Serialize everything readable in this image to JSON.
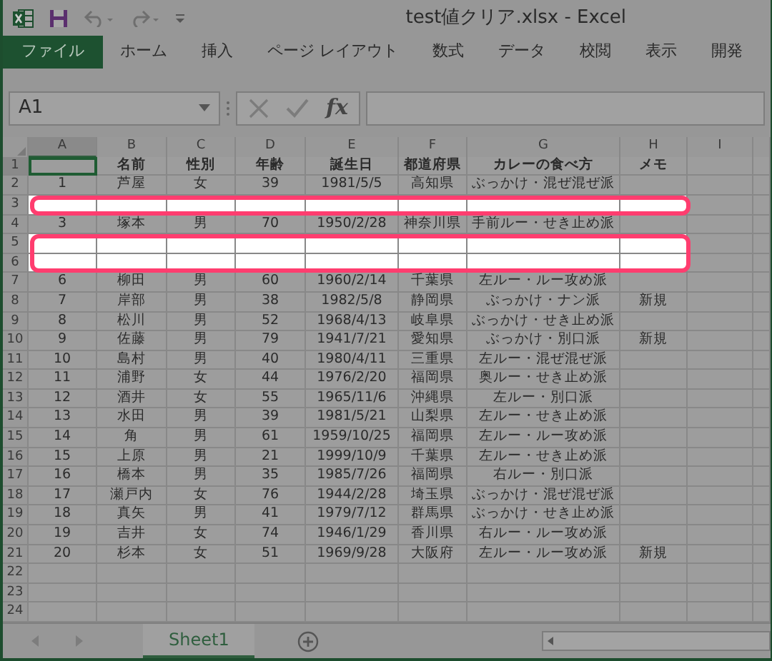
{
  "window": {
    "title": "test値クリア.xlsx - Excel"
  },
  "ribbon_tabs": [
    {
      "label": "ファイル",
      "kind": "file"
    },
    {
      "label": "ホーム",
      "kind": "tab"
    },
    {
      "label": "挿入",
      "kind": "tab"
    },
    {
      "label": "ページ レイアウト",
      "kind": "tab"
    },
    {
      "label": "数式",
      "kind": "tab"
    },
    {
      "label": "データ",
      "kind": "tab"
    },
    {
      "label": "校閲",
      "kind": "tab"
    },
    {
      "label": "表示",
      "kind": "tab"
    },
    {
      "label": "開発",
      "kind": "tab"
    }
  ],
  "name_box": "A1",
  "function_label": "fx",
  "columns": [
    {
      "label": "A",
      "selected": true
    },
    {
      "label": "B",
      "selected": false
    },
    {
      "label": "C",
      "selected": false
    },
    {
      "label": "D",
      "selected": false
    },
    {
      "label": "E",
      "selected": false
    },
    {
      "label": "F",
      "selected": false
    },
    {
      "label": "G",
      "selected": false
    },
    {
      "label": "H",
      "selected": false
    },
    {
      "label": "I",
      "selected": false
    }
  ],
  "rows": [
    {
      "number": "1",
      "kind": "header",
      "selected": true,
      "highlighted": false,
      "cells": {
        "B": "名前",
        "C": "性別",
        "D": "年齢",
        "E": "誕生日",
        "F": "都道府県",
        "G": "カレーの食べ方",
        "H": "メモ"
      }
    },
    {
      "number": "2",
      "kind": "data",
      "selected": false,
      "highlighted": false,
      "cells": {
        "A": "1",
        "B": "芦屋",
        "C": "女",
        "D": "39",
        "E": "1981/5/5",
        "F": "高知県",
        "G": "ぶっかけ・混ぜ混ぜ派"
      }
    },
    {
      "number": "3",
      "kind": "data",
      "selected": false,
      "highlighted": true,
      "cells": {}
    },
    {
      "number": "4",
      "kind": "data",
      "selected": false,
      "highlighted": false,
      "cells": {
        "A": "3",
        "B": "塚本",
        "C": "男",
        "D": "70",
        "E": "1950/2/28",
        "F": "神奈川県",
        "G": "手前ルー・せき止め派"
      }
    },
    {
      "number": "5",
      "kind": "data",
      "selected": false,
      "highlighted": true,
      "cells": {}
    },
    {
      "number": "6",
      "kind": "data",
      "selected": false,
      "highlighted": true,
      "cells": {}
    },
    {
      "number": "7",
      "kind": "data",
      "selected": false,
      "highlighted": false,
      "cells": {
        "A": "6",
        "B": "柳田",
        "C": "男",
        "D": "60",
        "E": "1960/2/14",
        "F": "千葉県",
        "G": "左ルー・ルー攻め派"
      }
    },
    {
      "number": "8",
      "kind": "data",
      "selected": false,
      "highlighted": false,
      "cells": {
        "A": "7",
        "B": "岸部",
        "C": "男",
        "D": "38",
        "E": "1982/5/8",
        "F": "静岡県",
        "G": "ぶっかけ・ナン派",
        "H": "新規"
      }
    },
    {
      "number": "9",
      "kind": "data",
      "selected": false,
      "highlighted": false,
      "cells": {
        "A": "8",
        "B": "松川",
        "C": "男",
        "D": "52",
        "E": "1968/4/13",
        "F": "岐阜県",
        "G": "ぶっかけ・せき止め派"
      }
    },
    {
      "number": "10",
      "kind": "data",
      "selected": false,
      "highlighted": false,
      "cells": {
        "A": "9",
        "B": "佐藤",
        "C": "男",
        "D": "79",
        "E": "1941/7/21",
        "F": "愛知県",
        "G": "ぶっかけ・別口派",
        "H": "新規"
      }
    },
    {
      "number": "11",
      "kind": "data",
      "selected": false,
      "highlighted": false,
      "cells": {
        "A": "10",
        "B": "島村",
        "C": "男",
        "D": "40",
        "E": "1980/4/11",
        "F": "三重県",
        "G": "左ルー・混ぜ混ぜ派"
      }
    },
    {
      "number": "12",
      "kind": "data",
      "selected": false,
      "highlighted": false,
      "cells": {
        "A": "11",
        "B": "浦野",
        "C": "女",
        "D": "44",
        "E": "1976/2/20",
        "F": "福岡県",
        "G": "奥ルー・せき止め派"
      }
    },
    {
      "number": "13",
      "kind": "data",
      "selected": false,
      "highlighted": false,
      "cells": {
        "A": "12",
        "B": "酒井",
        "C": "女",
        "D": "55",
        "E": "1965/11/6",
        "F": "沖縄県",
        "G": "左ルー・別口派"
      }
    },
    {
      "number": "14",
      "kind": "data",
      "selected": false,
      "highlighted": false,
      "cells": {
        "A": "13",
        "B": "水田",
        "C": "男",
        "D": "39",
        "E": "1981/5/21",
        "F": "山梨県",
        "G": "左ルー・せき止め派"
      }
    },
    {
      "number": "15",
      "kind": "data",
      "selected": false,
      "highlighted": false,
      "cells": {
        "A": "14",
        "B": "角",
        "C": "男",
        "D": "61",
        "E": "1959/10/25",
        "F": "福岡県",
        "G": "左ルー・ルー攻め派"
      }
    },
    {
      "number": "16",
      "kind": "data",
      "selected": false,
      "highlighted": false,
      "cells": {
        "A": "15",
        "B": "上原",
        "C": "男",
        "D": "21",
        "E": "1999/10/9",
        "F": "千葉県",
        "G": "左ルー・せき止め派"
      }
    },
    {
      "number": "17",
      "kind": "data",
      "selected": false,
      "highlighted": false,
      "cells": {
        "A": "16",
        "B": "橋本",
        "C": "男",
        "D": "35",
        "E": "1985/7/26",
        "F": "福岡県",
        "G": "右ルー・別口派"
      }
    },
    {
      "number": "18",
      "kind": "data",
      "selected": false,
      "highlighted": false,
      "cells": {
        "A": "17",
        "B": "瀬戸内",
        "C": "女",
        "D": "76",
        "E": "1944/2/28",
        "F": "埼玉県",
        "G": "ぶっかけ・混ぜ混ぜ派"
      }
    },
    {
      "number": "19",
      "kind": "data",
      "selected": false,
      "highlighted": false,
      "cells": {
        "A": "18",
        "B": "真矢",
        "C": "男",
        "D": "41",
        "E": "1979/7/12",
        "F": "群馬県",
        "G": "ぶっかけ・せき止め派"
      }
    },
    {
      "number": "20",
      "kind": "data",
      "selected": false,
      "highlighted": false,
      "cells": {
        "A": "19",
        "B": "吉井",
        "C": "女",
        "D": "74",
        "E": "1946/1/29",
        "F": "香川県",
        "G": "右ルー・ルー攻め派"
      }
    },
    {
      "number": "21",
      "kind": "data",
      "selected": false,
      "highlighted": false,
      "cells": {
        "A": "20",
        "B": "杉本",
        "C": "女",
        "D": "51",
        "E": "1969/9/28",
        "F": "大阪府",
        "G": "左ルー・ルー攻め派",
        "H": "新規"
      }
    },
    {
      "number": "22",
      "kind": "data",
      "selected": false,
      "highlighted": false,
      "cells": {}
    },
    {
      "number": "23",
      "kind": "data",
      "selected": false,
      "highlighted": false,
      "cells": {}
    },
    {
      "number": "24",
      "kind": "data",
      "selected": false,
      "highlighted": false,
      "cells": {}
    }
  ],
  "sheet_tabs": [
    {
      "label": "Sheet1",
      "selected": true
    }
  ]
}
